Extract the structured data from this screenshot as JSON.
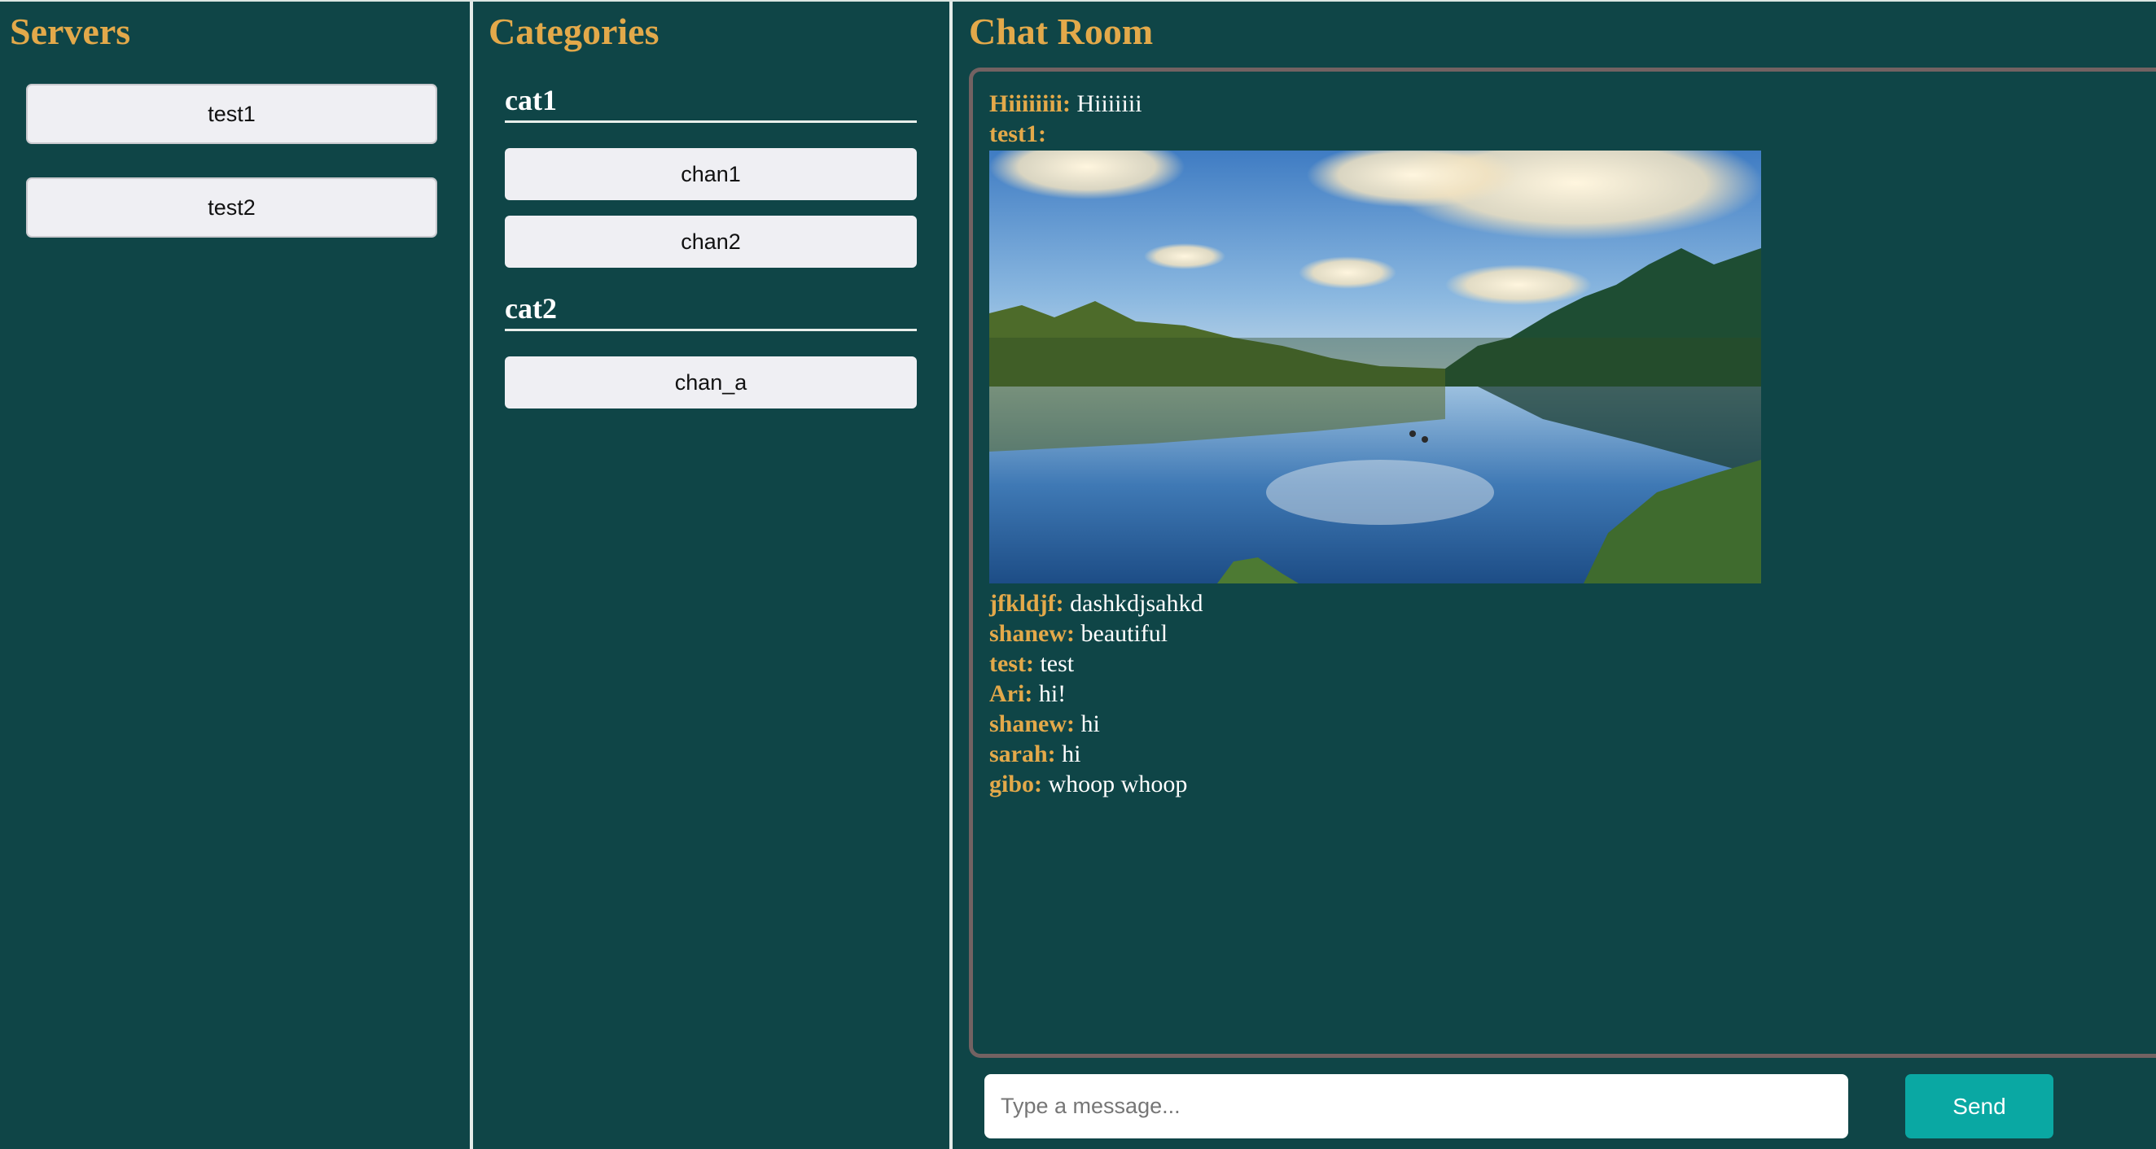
{
  "servers": {
    "title": "Servers",
    "items": [
      {
        "label": "test1"
      },
      {
        "label": "test2"
      }
    ]
  },
  "categories": {
    "title": "Categories",
    "groups": [
      {
        "name": "cat1",
        "channels": [
          {
            "label": "chan1"
          },
          {
            "label": "chan2"
          }
        ]
      },
      {
        "name": "cat2",
        "channels": [
          {
            "label": "chan_a"
          }
        ]
      }
    ]
  },
  "chat": {
    "title": "Chat Room",
    "messages": [
      {
        "user": "Hiiiiiiii:",
        "text": "Hiiiiiii"
      },
      {
        "user": "test1:",
        "text": "",
        "image": "lake-forest-landscape"
      },
      {
        "user": "jfkldjf:",
        "text": "dashkdjsahkd"
      },
      {
        "user": "shanew:",
        "text": "beautiful"
      },
      {
        "user": "test:",
        "text": "test"
      },
      {
        "user": "Ari:",
        "text": "hi!"
      },
      {
        "user": "shanew:",
        "text": "hi"
      },
      {
        "user": "sarah:",
        "text": "hi"
      },
      {
        "user": "gibo:",
        "text": "whoop whoop"
      }
    ],
    "input": {
      "placeholder": "Type a message...",
      "value": ""
    },
    "send_label": "Send"
  },
  "colors": {
    "background": "#0f4547",
    "accent": "#e3a94a",
    "send_button": "#0aa8a3",
    "chat_border": "#736262"
  }
}
